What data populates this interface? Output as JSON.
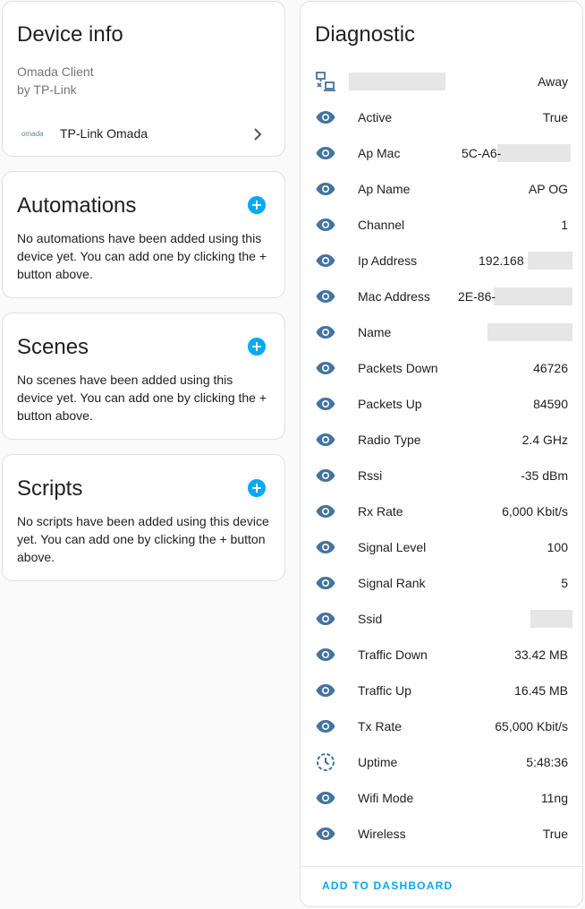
{
  "device_info": {
    "title": "Device info",
    "model": "Omada Client",
    "manufacturer": "by TP-Link",
    "integration_logo_text": "omada",
    "integration_name": "TP-Link Omada"
  },
  "automations": {
    "title": "Automations",
    "text": "No automations have been added using this device yet. You can add one by clicking the + button above."
  },
  "scenes": {
    "title": "Scenes",
    "text": "No scenes have been added using this device yet. You can add one by clicking the + button above."
  },
  "scripts": {
    "title": "Scripts",
    "text": "No scripts have been added using this device yet. You can add one by clicking the + button above."
  },
  "diagnostic": {
    "title": "Diagnostic",
    "footer": "ADD TO DASHBOARD",
    "rows": [
      {
        "icon": "network-off-icon",
        "name": "",
        "value": "Away"
      },
      {
        "icon": "eye-icon",
        "name": "Active",
        "value": "True"
      },
      {
        "icon": "eye-icon",
        "name": "Ap Mac",
        "value": "5C-A6-"
      },
      {
        "icon": "eye-icon",
        "name": "Ap Name",
        "value": "AP OG"
      },
      {
        "icon": "eye-icon",
        "name": "Channel",
        "value": "1"
      },
      {
        "icon": "eye-icon",
        "name": "Ip Address",
        "value": "192.168"
      },
      {
        "icon": "eye-icon",
        "name": "Mac Address",
        "value": "2E-86-"
      },
      {
        "icon": "eye-icon",
        "name": "Name",
        "value": ""
      },
      {
        "icon": "eye-icon",
        "name": "Packets Down",
        "value": "46726"
      },
      {
        "icon": "eye-icon",
        "name": "Packets Up",
        "value": "84590"
      },
      {
        "icon": "eye-icon",
        "name": "Radio Type",
        "value": "2.4 GHz"
      },
      {
        "icon": "eye-icon",
        "name": "Rssi",
        "value": "-35 dBm"
      },
      {
        "icon": "eye-icon",
        "name": "Rx Rate",
        "value": "6,000 Kbit/s"
      },
      {
        "icon": "eye-icon",
        "name": "Signal Level",
        "value": "100"
      },
      {
        "icon": "eye-icon",
        "name": "Signal Rank",
        "value": "5"
      },
      {
        "icon": "eye-icon",
        "name": "Ssid",
        "value": ""
      },
      {
        "icon": "eye-icon",
        "name": "Traffic Down",
        "value": "33.42 MB"
      },
      {
        "icon": "eye-icon",
        "name": "Traffic Up",
        "value": "16.45 MB"
      },
      {
        "icon": "eye-icon",
        "name": "Tx Rate",
        "value": "65,000 Kbit/s"
      },
      {
        "icon": "clock-icon",
        "name": "Uptime",
        "value": "5:48:36"
      },
      {
        "icon": "eye-icon",
        "name": "Wifi Mode",
        "value": "11ng"
      },
      {
        "icon": "eye-icon",
        "name": "Wireless",
        "value": "True"
      }
    ]
  },
  "colors": {
    "accent": "#03a9f4",
    "icon": "#44739e"
  }
}
